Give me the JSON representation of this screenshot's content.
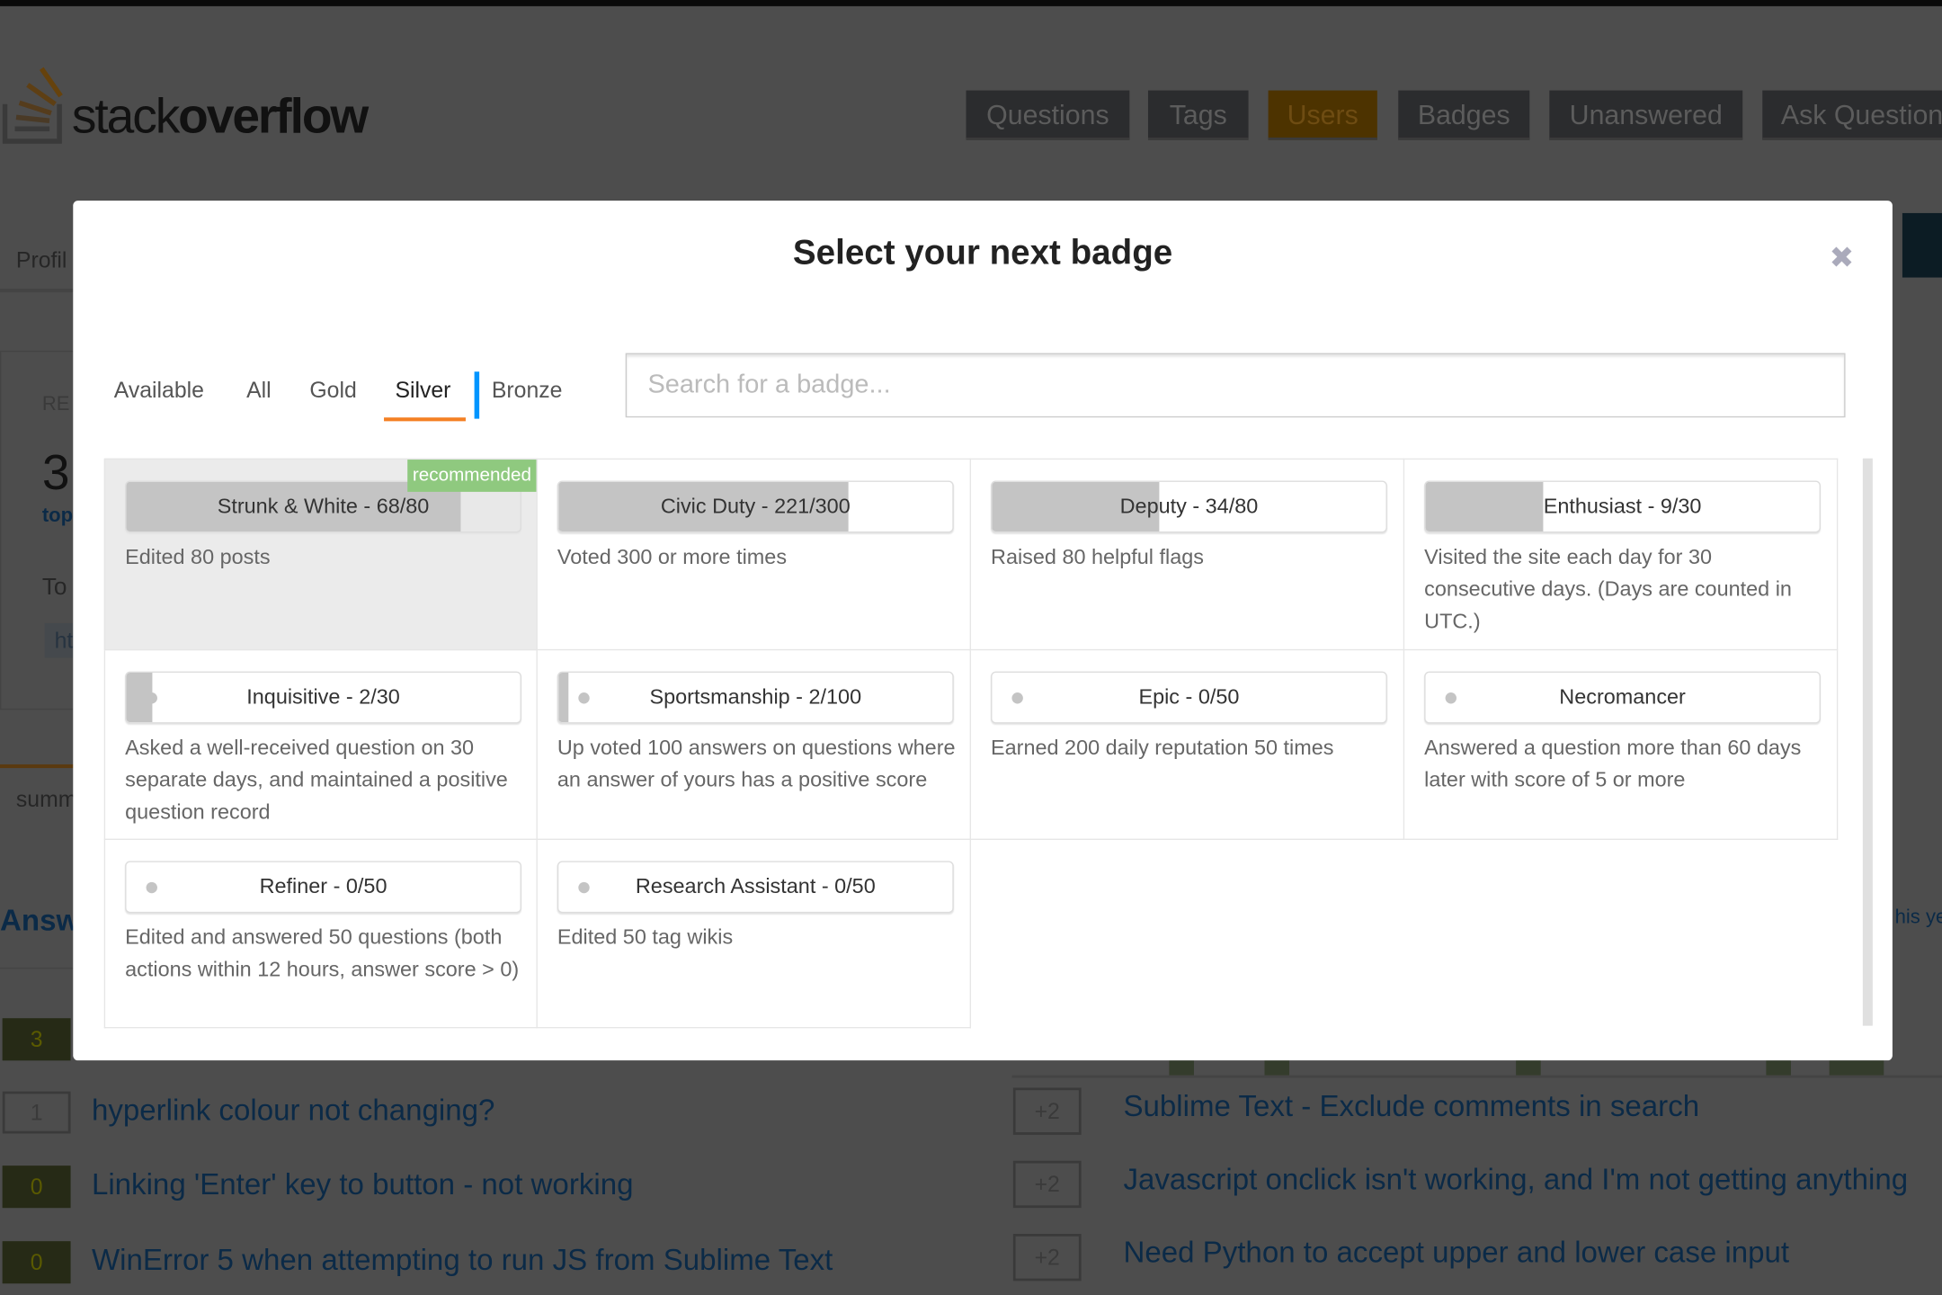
{
  "header": {
    "logo": {
      "light": "stack",
      "bold": "overflow"
    },
    "nav": [
      {
        "label": "Questions",
        "active": false
      },
      {
        "label": "Tags",
        "active": false
      },
      {
        "label": "Users",
        "active": true
      },
      {
        "label": "Badges",
        "active": false
      },
      {
        "label": "Unanswered",
        "active": false
      },
      {
        "label": "Ask Question",
        "active": false
      }
    ]
  },
  "background": {
    "profile_tab": "Profil",
    "rep_label": "RE",
    "rep_value": "3",
    "top_link": "top",
    "top_tags": "To",
    "tag": "ht",
    "summary_tab": "summ",
    "answers_heading": "Answ",
    "this_year": "his ye",
    "left_questions": [
      {
        "votes": "3",
        "title": "",
        "accepted": true
      },
      {
        "votes": "1",
        "title": "hyperlink colour not changing?",
        "accepted": false
      },
      {
        "votes": "0",
        "title": "Linking 'Enter' key to button - not working",
        "accepted": true
      },
      {
        "votes": "0",
        "title": "WinError 5 when attempting to run JS from Sublime Text",
        "accepted": true
      }
    ],
    "right_questions": [
      {
        "votes": "+2",
        "title": "Sublime Text - Exclude comments in search"
      },
      {
        "votes": "+2",
        "title": "Javascript onclick isn't working, and I'm not getting anything"
      },
      {
        "votes": "+2",
        "title": "Need Python to accept upper and lower case input"
      }
    ]
  },
  "modal": {
    "title": "Select your next badge",
    "close_icon": "close-icon",
    "tabs": [
      {
        "label": "Available",
        "selected": false
      },
      {
        "label": "All",
        "selected": false
      },
      {
        "label": "Gold",
        "selected": false
      },
      {
        "label": "Silver",
        "selected": true
      },
      {
        "label": "Bronze",
        "selected": false
      }
    ],
    "search": {
      "placeholder": "Search for a badge...",
      "value": ""
    },
    "recommended_label": "recommended",
    "badges": [
      {
        "label": "Strunk & White - 68/80",
        "progress": 0.85,
        "desc": "Edited 80 posts",
        "recommended": true
      },
      {
        "label": "Civic Duty - 221/300",
        "progress": 0.737,
        "desc": "Voted 300 or more times"
      },
      {
        "label": "Deputy - 34/80",
        "progress": 0.425,
        "desc": "Raised 80 helpful flags"
      },
      {
        "label": "Enthusiast - 9/30",
        "progress": 0.3,
        "desc": "Visited the site each day for 30 consecutive days. (Days are counted in UTC.)"
      },
      {
        "label": "Inquisitive - 2/30",
        "progress": 0.067,
        "desc": "Asked a well-received question on 30 separate days, and maintained a positive question record"
      },
      {
        "label": "Sportsmanship - 2/100",
        "progress": 0.02,
        "desc": "Up voted 100 answers on questions where an answer of yours has a positive score"
      },
      {
        "label": "Epic - 0/50",
        "progress": 0,
        "desc": "Earned 200 daily reputation 50 times"
      },
      {
        "label": "Necromancer",
        "progress": 0,
        "desc": "Answered a question more than 60 days later with score of 5 or more"
      },
      {
        "label": "Refiner - 0/50",
        "progress": 0,
        "desc": "Edited and answered 50 questions (both actions within 12 hours, answer score > 0)"
      },
      {
        "label": "Research Assistant - 0/50",
        "progress": 0,
        "desc": "Edited 50 tag wikis"
      }
    ]
  },
  "colors": {
    "accent": "#f48024",
    "tab_separator": "#0095ff",
    "recommended": "#8fc97f",
    "progress_fill": "#c4c4c4"
  }
}
